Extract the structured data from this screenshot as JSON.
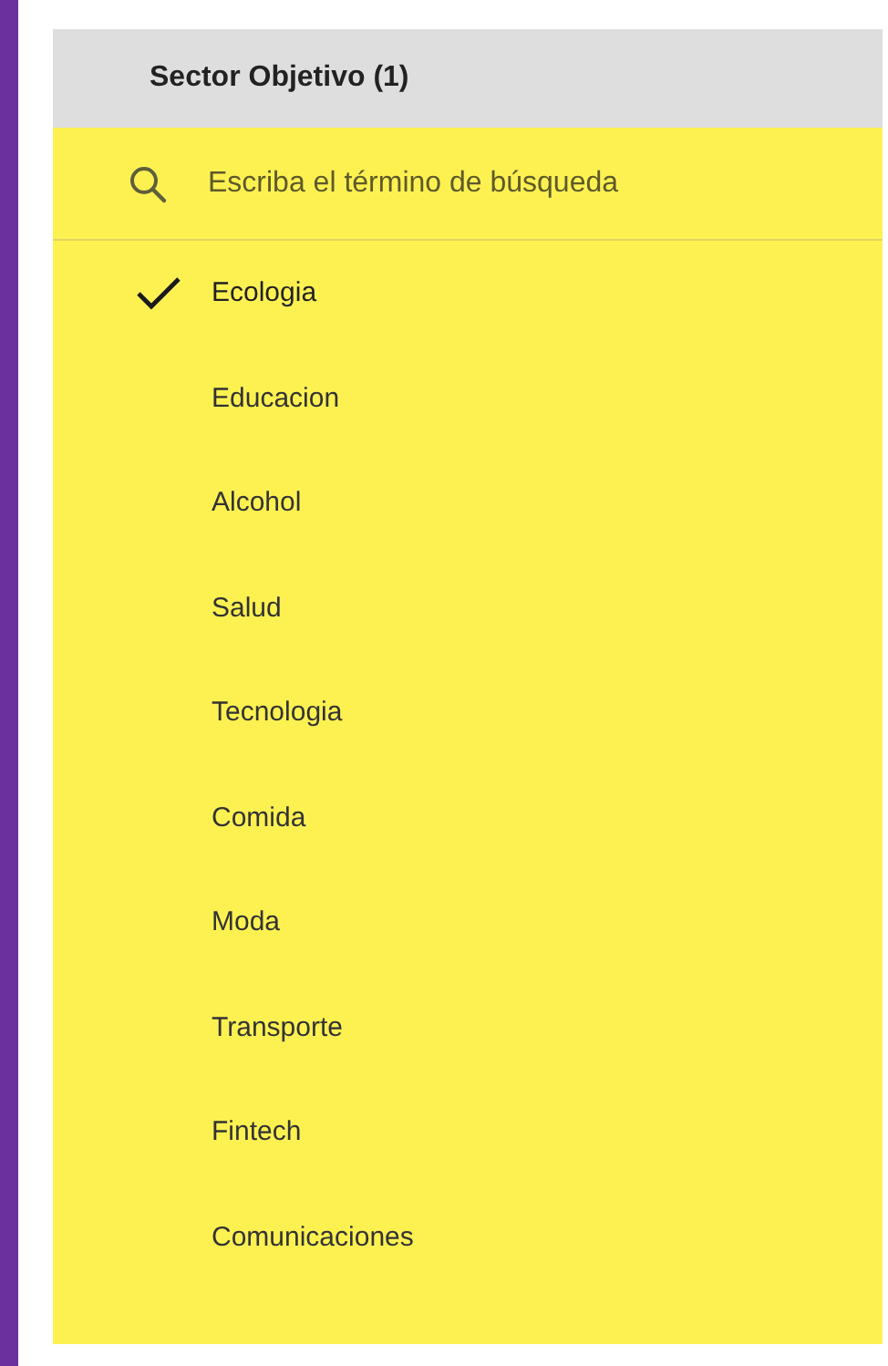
{
  "panel": {
    "title": "Sector Objetivo (1)"
  },
  "search": {
    "placeholder": "Escriba el término de búsqueda"
  },
  "options": [
    {
      "label": "Ecologia",
      "selected": true
    },
    {
      "label": "Educacion",
      "selected": false
    },
    {
      "label": "Alcohol",
      "selected": false
    },
    {
      "label": "Salud",
      "selected": false
    },
    {
      "label": "Tecnologia",
      "selected": false
    },
    {
      "label": "Comida",
      "selected": false
    },
    {
      "label": "Moda",
      "selected": false
    },
    {
      "label": "Transporte",
      "selected": false
    },
    {
      "label": "Fintech",
      "selected": false
    },
    {
      "label": "Comunicaciones",
      "selected": false
    }
  ]
}
